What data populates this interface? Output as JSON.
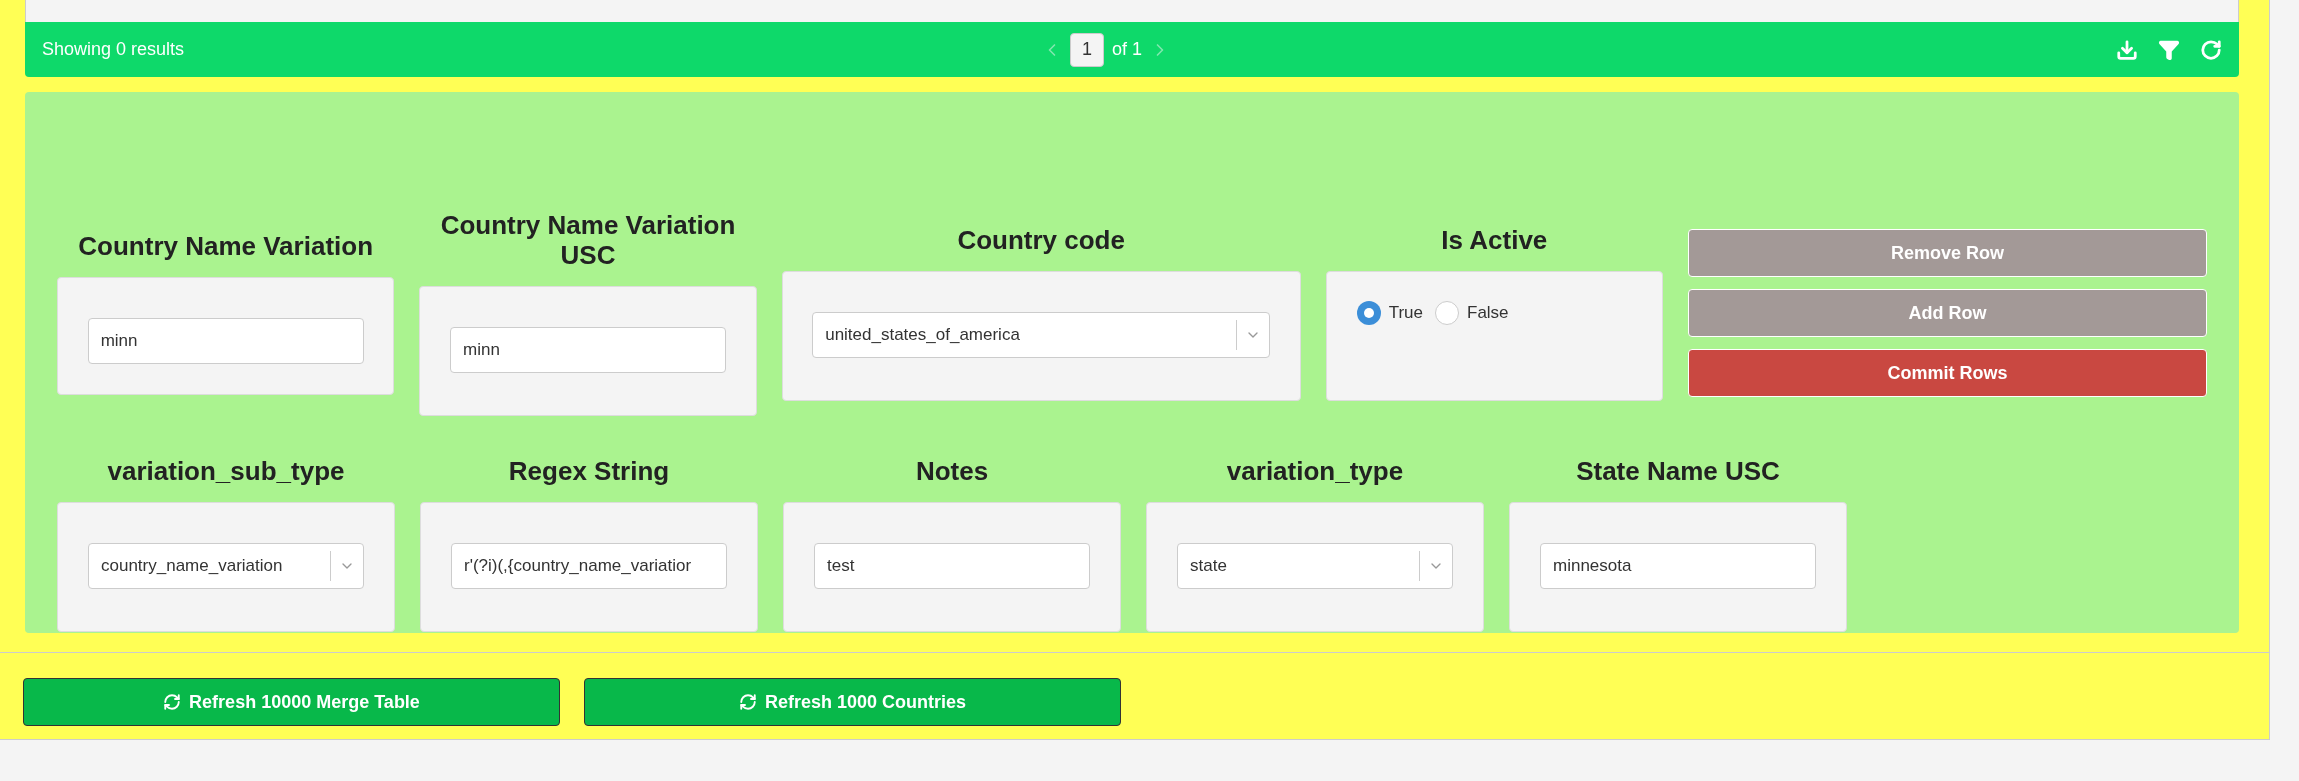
{
  "results_bar": {
    "summary": "Showing 0 results",
    "page": "1",
    "page_total": "of 1"
  },
  "form_rows": [
    [
      {
        "kind": "text",
        "label": "Country Name Variation",
        "value": "minn"
      },
      {
        "kind": "text",
        "label": "Country Name Variation USC",
        "value": "minn"
      },
      {
        "kind": "select",
        "label": "Country code",
        "value": "united_states_of_america"
      },
      {
        "kind": "radio",
        "label": "Is Active",
        "options": [
          {
            "label": "True",
            "selected": true
          },
          {
            "label": "False",
            "selected": false
          }
        ]
      }
    ],
    [
      {
        "kind": "select",
        "label": "variation_sub_type",
        "value": "country_name_variation"
      },
      {
        "kind": "text",
        "label": "Regex String",
        "value": "r'(?i)(,{country_name_variatior"
      },
      {
        "kind": "text",
        "label": "Notes",
        "value": "test"
      },
      {
        "kind": "select",
        "label": "variation_type",
        "value": "state"
      },
      {
        "kind": "text",
        "label": "State Name USC",
        "value": "minnesota"
      }
    ]
  ],
  "row_actions": [
    {
      "label": "Remove Row",
      "kind": "neutral"
    },
    {
      "label": "Add Row",
      "kind": "neutral"
    },
    {
      "label": "Commit Rows",
      "kind": "danger"
    }
  ],
  "footer_buttons": [
    {
      "label": "Refresh 10000 Merge Table"
    },
    {
      "label": "Refresh 1000 Countries"
    }
  ]
}
